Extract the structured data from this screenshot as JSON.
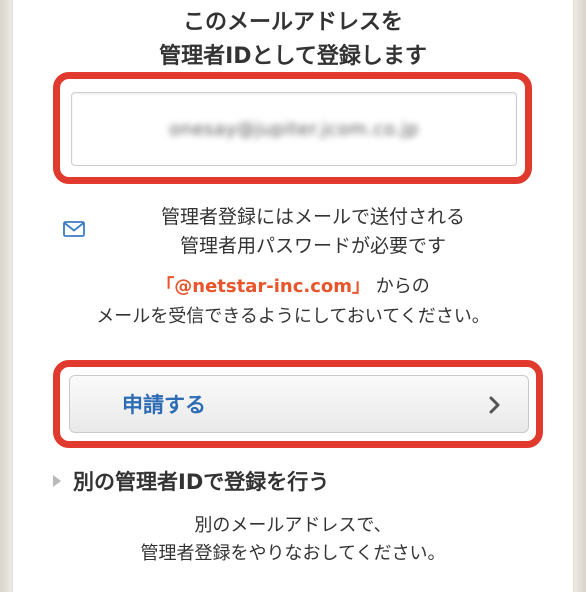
{
  "heading": {
    "line1": "このメールアドレスを",
    "line2": "管理者IDとして登録します"
  },
  "email": {
    "value": "onesay@jupiter.jcom.co.jp"
  },
  "info": {
    "icon": "mail-icon",
    "line1": "管理者登録にはメールで送付される",
    "line2": "管理者用パスワードが必要です"
  },
  "notice": {
    "domain": "「@netstar-inc.com」",
    "domain_suffix": " からの",
    "line2": "メールを受信できるようにしておいてください。"
  },
  "apply_button": {
    "label": "申請する",
    "icon": "chevron-right-icon"
  },
  "alternate": {
    "link_label": "別の管理者IDで登録を行う",
    "desc_line1": "別のメールアドレスで、",
    "desc_line2": "管理者登録をやりなおしてください。"
  },
  "colors": {
    "highlight": "#e03a2f",
    "link_blue": "#2d6cb5",
    "domain_orange": "#e8552a"
  }
}
